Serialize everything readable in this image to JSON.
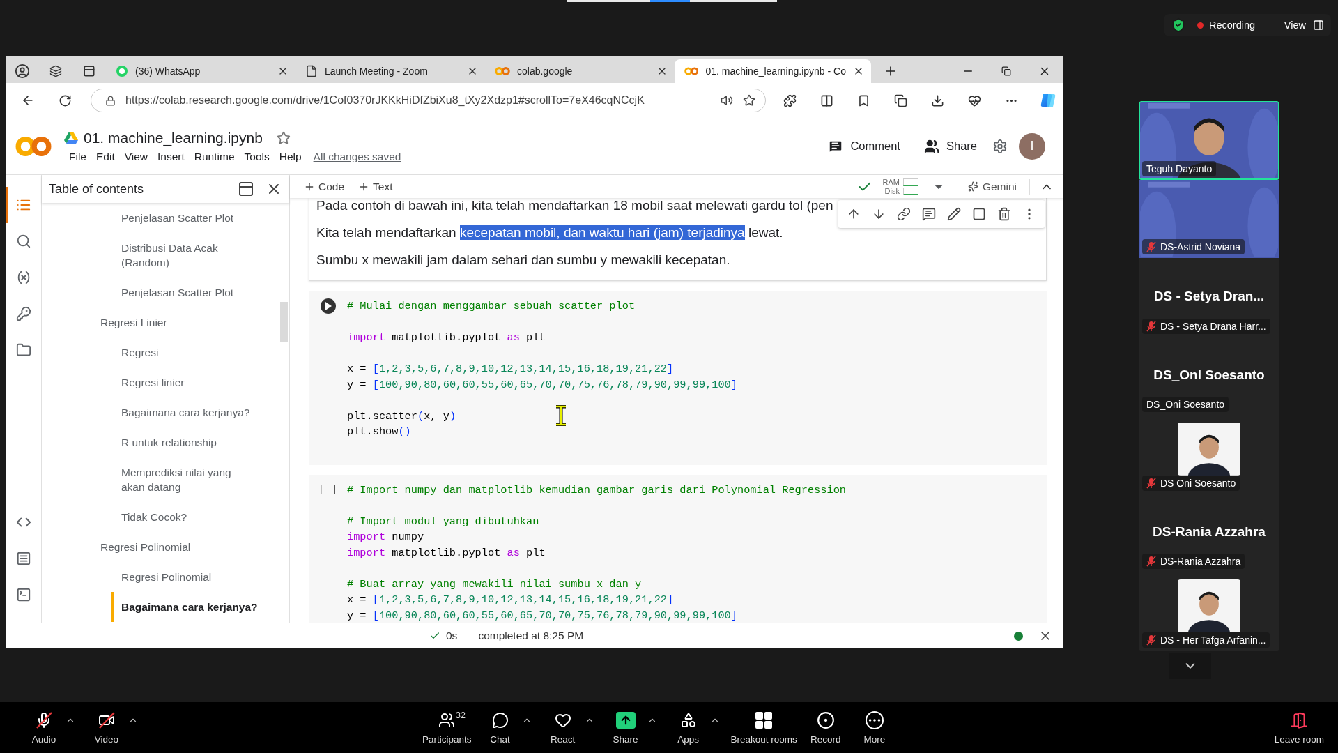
{
  "meeting": {
    "recording": "Recording",
    "view": "View"
  },
  "browser": {
    "tabs": [
      {
        "title": "(36) WhatsApp",
        "kind": "whatsapp",
        "selected": false
      },
      {
        "title": "Launch Meeting - Zoom",
        "kind": "page",
        "selected": false
      },
      {
        "title": "colab.google",
        "kind": "colab",
        "selected": false
      },
      {
        "title": "01. machine_learning.ipynb - Co",
        "kind": "colab",
        "selected": true
      }
    ],
    "url": "https://colab.research.google.com/drive/1Cof0370rJKKkHiDfZbiXu8_tXy2Xdzp1#scrollTo=7eX46cqNCcjK"
  },
  "notebook": {
    "title": "01. machine_learning.ipynb",
    "menus": [
      "File",
      "Edit",
      "View",
      "Insert",
      "Runtime",
      "Tools",
      "Help"
    ],
    "save_status": "All changes saved",
    "comment": "Comment",
    "share": "Share",
    "avatar": "I",
    "rail": [
      {
        "kind": "toc",
        "selected": true
      },
      {
        "kind": "search",
        "selected": false
      },
      {
        "kind": "variables",
        "selected": false
      },
      {
        "kind": "secrets",
        "selected": false
      },
      {
        "kind": "files",
        "selected": false
      },
      {
        "kind": "snippets",
        "selected": false
      },
      {
        "kind": "commands",
        "selected": false
      },
      {
        "kind": "terminal",
        "selected": false
      }
    ],
    "toc": {
      "title": "Table of contents",
      "items": [
        {
          "children": [
            {
              "label": "Penjelasan Scatter Plot",
              "selected": false
            },
            {
              "label": "Distribusi Data Acak (Random)",
              "selected": false
            },
            {
              "label": "Penjelasan Scatter Plot",
              "selected": false
            }
          ]
        },
        {
          "label": "Regresi Linier",
          "selected": false,
          "children": [
            {
              "label": "Regresi",
              "selected": false
            },
            {
              "label": "Regresi linier",
              "selected": false
            },
            {
              "label": "Bagaimana cara kerjanya?",
              "selected": false
            },
            {
              "label": "R untuk relationship",
              "selected": false
            },
            {
              "label": "Memprediksi nilai yang akan datang",
              "selected": false
            },
            {
              "label": "Tidak Cocok?",
              "selected": false
            }
          ]
        },
        {
          "label": "Regresi Polinomial",
          "selected": false,
          "children": [
            {
              "label": "Regresi Polinomial",
              "selected": false
            },
            {
              "label": "Bagaimana cara kerjanya?",
              "selected": true
            }
          ]
        }
      ]
    },
    "toolbar": {
      "add_code": "Code",
      "add_text": "Text",
      "ram": "RAM",
      "disk": "Disk",
      "gemini": "Gemini"
    },
    "cells": [
      {
        "kind": "text",
        "focused": true,
        "paragraphs": [
          [
            {
              "text": "Pada contoh di bawah ini, kita telah mendaftarkan 18 mobil saat melewati gardu tol (pen",
              "selected": false
            }
          ],
          [
            {
              "text": "Kita telah mendaftarkan ",
              "selected": false
            },
            {
              "text": "kecepatan mobil, dan waktu hari (jam) terjadinya",
              "selected": true
            },
            {
              "text": " lewat.",
              "selected": false
            }
          ],
          [
            {
              "text": "Sumbu x mewakili jam dalam sehari dan sumbu y mewakili kecepatan.",
              "selected": false
            }
          ]
        ]
      },
      {
        "kind": "code",
        "hovered": true,
        "blocks": [
          [
            [
              {
                "text": "# Mulai dengan menggambar sebuah scatter plot",
                "kind": "comment"
              }
            ]
          ],
          [
            [
              {
                "text": "import",
                "kind": "keyword"
              },
              {
                "text": " matplotlib.pyplot ",
                "kind": "plain"
              },
              {
                "text": "as",
                "kind": "keyword"
              },
              {
                "text": " plt",
                "kind": "plain"
              }
            ]
          ],
          [
            [
              {
                "text": "x = ",
                "kind": "plain"
              },
              {
                "text": "[",
                "kind": "bracket"
              },
              {
                "text": "1,2,3,5,6,7,8,9,10,12,13,14,15,16,18,19,21,22",
                "kind": "number"
              },
              {
                "text": "]",
                "kind": "bracket"
              }
            ],
            [
              {
                "text": "y = ",
                "kind": "plain"
              },
              {
                "text": "[",
                "kind": "bracket"
              },
              {
                "text": "100,90,80,60,60,55,60,65,70,70,75,76,78,79,90,99,99,100",
                "kind": "number"
              },
              {
                "text": "]",
                "kind": "bracket"
              }
            ]
          ],
          [
            [
              {
                "text": "plt.scatter",
                "kind": "plain"
              },
              {
                "text": "(",
                "kind": "bracket"
              },
              {
                "text": "x, y",
                "kind": "plain"
              },
              {
                "text": ")",
                "kind": "bracket"
              }
            ],
            [
              {
                "text": "plt.show",
                "kind": "plain"
              },
              {
                "text": "()",
                "kind": "bracket"
              }
            ]
          ]
        ]
      },
      {
        "kind": "code",
        "hovered": false,
        "prompt": "[ ]",
        "blocks": [
          [
            [
              {
                "text": "# Import numpy dan matplotlib kemudian gambar garis dari Polynomial Regression",
                "kind": "comment"
              }
            ]
          ],
          [
            [
              {
                "text": "# Import modul yang dibutuhkan",
                "kind": "comment"
              }
            ],
            [
              {
                "text": "import",
                "kind": "keyword"
              },
              {
                "text": " numpy",
                "kind": "plain"
              }
            ],
            [
              {
                "text": "import",
                "kind": "keyword"
              },
              {
                "text": " matplotlib.pyplot ",
                "kind": "plain"
              },
              {
                "text": "as",
                "kind": "keyword"
              },
              {
                "text": " plt",
                "kind": "plain"
              }
            ]
          ],
          [
            [
              {
                "text": "# Buat array yang mewakili nilai sumbu x dan y",
                "kind": "comment"
              }
            ],
            [
              {
                "text": "x = ",
                "kind": "plain"
              },
              {
                "text": "[",
                "kind": "bracket"
              },
              {
                "text": "1,2,3,5,6,7,8,9,10,12,13,14,15,16,18,19,21,22",
                "kind": "number"
              },
              {
                "text": "]",
                "kind": "bracket"
              }
            ],
            [
              {
                "text": "y = ",
                "kind": "plain"
              },
              {
                "text": "[",
                "kind": "bracket"
              },
              {
                "text": "100,90,80,60,60,55,60,65,70,70,75,76,78,79,90,99,99,100",
                "kind": "number"
              },
              {
                "text": "]",
                "kind": "bracket"
              }
            ]
          ]
        ]
      }
    ],
    "status": {
      "duration": "0s",
      "message": "completed at 8:25 PM"
    }
  },
  "participants": [
    {
      "kind": "video",
      "name": "Teguh Dayanto",
      "speaking": true,
      "muted": false
    },
    {
      "kind": "video",
      "name": "DS-Astrid Noviana",
      "speaking": false,
      "muted": true
    },
    {
      "kind": "name",
      "display": "DS - Setya Dran...",
      "name": "DS - Setya Drana Harr...",
      "speaking": false,
      "muted": true
    },
    {
      "kind": "name",
      "display": "DS_Oni Soesanto",
      "name": "DS_Oni Soesanto",
      "speaking": false,
      "muted": false
    },
    {
      "name": "DS Oni Soesanto",
      "speaking": false,
      "muted": true
    },
    {
      "kind": "name",
      "display": "DS-Rania Azzahra",
      "name": "DS-Rania Azzahra",
      "speaking": false,
      "muted": true
    },
    {
      "name": "DS - Her Tafga Arfanin...",
      "speaking": false,
      "muted": true
    }
  ],
  "controls": [
    {
      "kind": "audio",
      "label": "Audio",
      "off": true,
      "menu": true
    },
    {
      "kind": "video",
      "label": "Video",
      "off": true,
      "menu": true
    },
    {
      "kind": "participants",
      "label": "Participants",
      "count": "32",
      "off": false,
      "menu": false
    },
    {
      "kind": "chat",
      "label": "Chat",
      "off": false,
      "menu": true
    },
    {
      "kind": "react",
      "label": "React",
      "off": false,
      "menu": true
    },
    {
      "kind": "share",
      "label": "Share",
      "off": false,
      "menu": true
    },
    {
      "kind": "apps",
      "label": "Apps",
      "off": false,
      "menu": true
    },
    {
      "kind": "breakout",
      "label": "Breakout rooms",
      "off": false,
      "menu": false
    },
    {
      "kind": "record",
      "label": "Record",
      "off": false,
      "menu": false
    },
    {
      "kind": "more",
      "label": "More",
      "off": false,
      "menu": false
    },
    {
      "kind": "leave",
      "label": "Leave room",
      "off": false,
      "menu": false
    }
  ]
}
